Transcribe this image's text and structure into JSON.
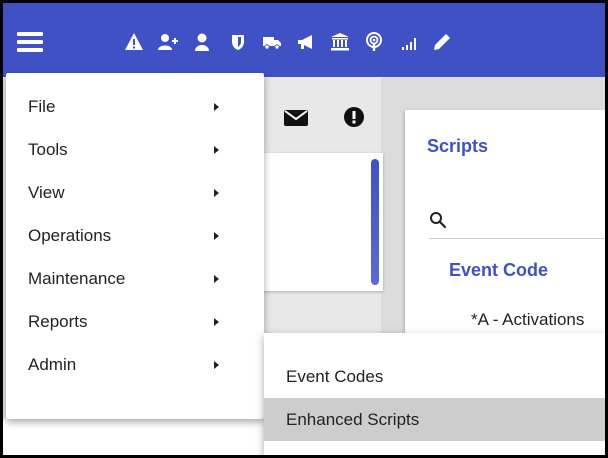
{
  "toolbar": {
    "icons": [
      "warning-icon",
      "add-user-icon",
      "user-icon",
      "shield-icon",
      "truck-icon",
      "megaphone-icon",
      "bank-icon",
      "podcast-icon",
      "signal-icon",
      "pencil-icon"
    ]
  },
  "colors": {
    "primary": "#3f51c4",
    "active_item": "#cdcdcd"
  },
  "main_menu": {
    "items": [
      {
        "label": "File"
      },
      {
        "label": "Tools"
      },
      {
        "label": "View"
      },
      {
        "label": "Operations"
      },
      {
        "label": "Maintenance"
      },
      {
        "label": "Reports"
      },
      {
        "label": "Admin"
      }
    ]
  },
  "submenu": {
    "items": [
      {
        "label": "Event Codes"
      },
      {
        "label": "Enhanced Scripts"
      }
    ]
  },
  "scripts_panel": {
    "title": "Scripts",
    "column_header": "Event Code",
    "rows": [
      {
        "code": "*A - Activations"
      }
    ]
  }
}
